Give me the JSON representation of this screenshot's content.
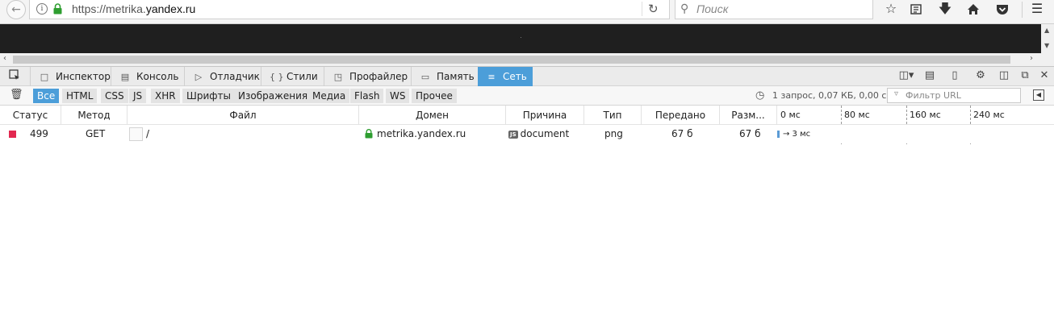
{
  "browser": {
    "url_prefix": "https://metrika.",
    "url_domain": "yandex.ru",
    "search_placeholder": "Поиск",
    "icons": [
      "back-icon",
      "info-icon",
      "lock-icon",
      "reload-icon",
      "search-icon",
      "star-icon",
      "reading-list-icon",
      "download-icon",
      "home-icon",
      "pocket-icon",
      "menu-icon"
    ]
  },
  "devtools": {
    "tabs": [
      {
        "label": "Инспектор",
        "icon": "inspector-icon"
      },
      {
        "label": "Консоль",
        "icon": "console-icon"
      },
      {
        "label": "Отладчик",
        "icon": "debugger-icon"
      },
      {
        "label": "Стили",
        "icon": "style-editor-icon"
      },
      {
        "label": "Профайлер",
        "icon": "profiler-icon"
      },
      {
        "label": "Память",
        "icon": "memory-icon"
      },
      {
        "label": "Сеть",
        "icon": "network-icon"
      }
    ],
    "selected_tab": "Сеть",
    "accent": "#4c9ed9"
  },
  "filters": {
    "buttons": [
      "Все",
      "HTML",
      "CSS",
      "JS",
      "XHR",
      "Шрифты",
      "Изображения",
      "Медиа",
      "Flash",
      "WS",
      "Прочее"
    ],
    "active": "Все",
    "summary": "1 запрос, 0,07 КБ, 0,00 с",
    "url_filter_placeholder": "Фильтр URL"
  },
  "table": {
    "headers": {
      "status": "Статус",
      "method": "Метод",
      "file": "Файл",
      "domain": "Домен",
      "cause": "Причина",
      "type": "Тип",
      "transferred": "Передано",
      "size": "Разм..."
    },
    "timeline_ticks": [
      "0 мс",
      "80 мс",
      "160 мс",
      "240 мс"
    ],
    "rows": [
      {
        "status": "499",
        "status_color": "#e22850",
        "method": "GET",
        "file": "/",
        "domain": "metrika.yandex.ru",
        "cause_badge": "JS",
        "cause": "document",
        "type": "png",
        "transferred": "67 б",
        "size": "67 б",
        "timing": "→ 3 мс"
      }
    ]
  }
}
